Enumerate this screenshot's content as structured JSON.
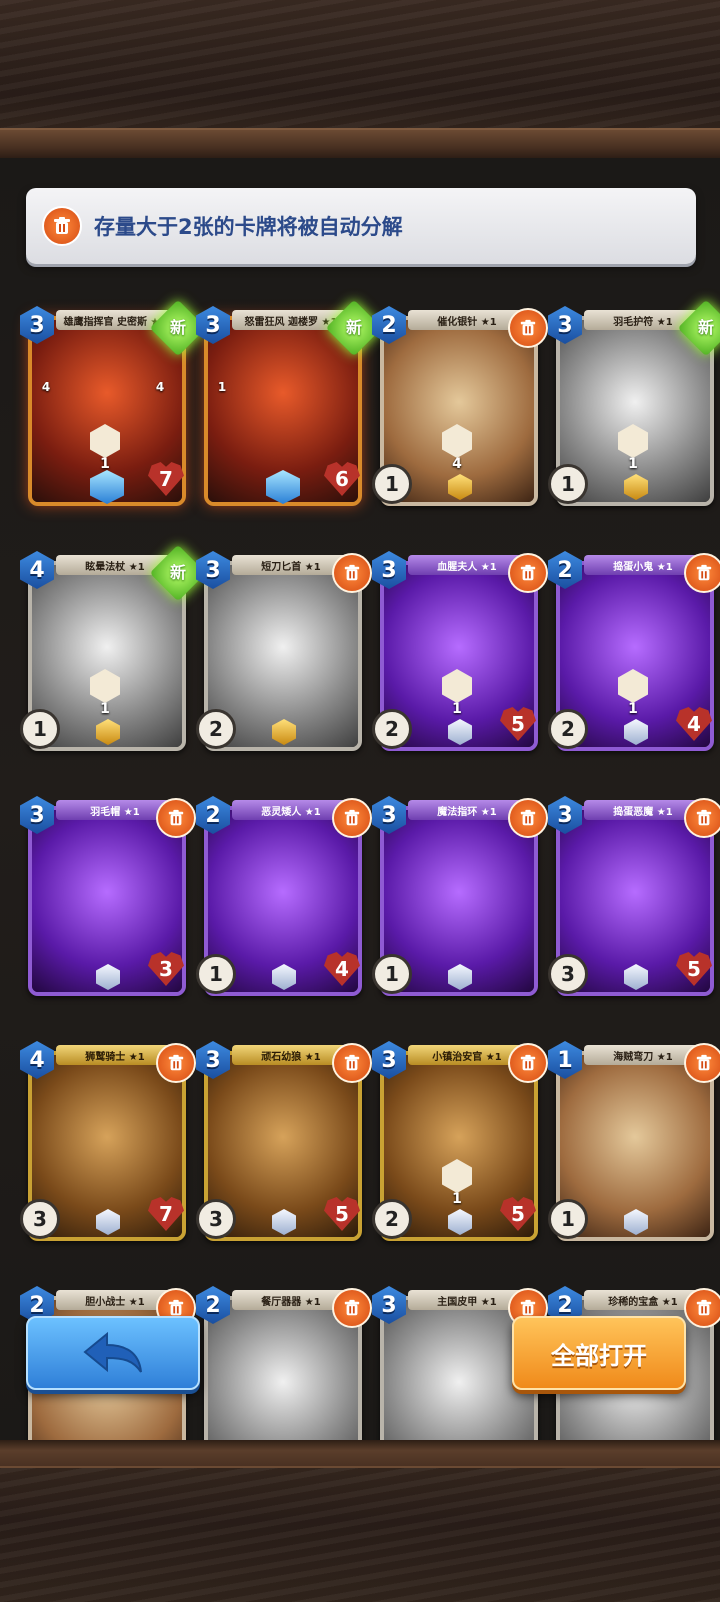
{
  "notice": {
    "text": "存量大于2张的卡牌将被自动分解",
    "icon": "trash-icon"
  },
  "cards": [
    {
      "name": "雄鹰指挥官 史密斯 ★1",
      "cost": "3",
      "badge": "新",
      "theme": "orange",
      "left_stat": "",
      "right_stat": "7",
      "skill1": "1",
      "side_left": "4",
      "side_right": "4",
      "rarity": "gem-blue"
    },
    {
      "name": "怒雷狂风 迦楼罗 ★1",
      "cost": "3",
      "badge": "新",
      "theme": "orange",
      "left_stat": "",
      "right_stat": "6",
      "skill1": "",
      "side_left": "1",
      "side_right": "",
      "rarity": "gem-blue"
    },
    {
      "name": "催化银针 ★1",
      "cost": "2",
      "badge": "trash",
      "theme": "red",
      "left_stat": "1",
      "right_stat": "",
      "skill1": "4",
      "rarity": "gem-gold"
    },
    {
      "name": "羽毛护符 ★1",
      "cost": "3",
      "badge": "新",
      "theme": "gray",
      "left_stat": "1",
      "right_stat": "",
      "skill1": "1",
      "rarity": "gem-gold"
    },
    {
      "name": "眩晕法杖 ★1",
      "cost": "4",
      "badge": "新",
      "theme": "gray",
      "left_stat": "1",
      "right_stat": "",
      "skill1": "1",
      "rarity": "gem-gold"
    },
    {
      "name": "短刀匕首 ★1",
      "cost": "3",
      "badge": "trash",
      "theme": "gray",
      "left_stat": "2",
      "right_stat": "",
      "skill1": "",
      "rarity": "gem-gold"
    },
    {
      "name": "血腥夫人 ★1",
      "cost": "3",
      "badge": "trash",
      "theme": "purple",
      "left_stat": "2",
      "right_stat": "5",
      "skill1": "1",
      "rarity": "gem-silver"
    },
    {
      "name": "捣蛋小鬼 ★1",
      "cost": "2",
      "badge": "trash",
      "theme": "purple",
      "left_stat": "2",
      "right_stat": "4",
      "skill1": "1",
      "rarity": "gem-silver"
    },
    {
      "name": "羽毛帽 ★1",
      "cost": "3",
      "badge": "trash",
      "theme": "purple",
      "left_stat": "",
      "right_stat": "3",
      "skill1": "",
      "rarity": "gem-silver"
    },
    {
      "name": "恶灵矮人 ★1",
      "cost": "2",
      "badge": "trash",
      "theme": "purple",
      "left_stat": "1",
      "right_stat": "4",
      "skill1": "",
      "rarity": "gem-silver"
    },
    {
      "name": "魔法指环 ★1",
      "cost": "3",
      "badge": "trash",
      "theme": "purple",
      "left_stat": "1",
      "right_stat": "",
      "skill1": "",
      "rarity": "gem-silver"
    },
    {
      "name": "捣蛋恶魔 ★1",
      "cost": "3",
      "badge": "trash",
      "theme": "purple",
      "left_stat": "3",
      "right_stat": "5",
      "skill1": "",
      "rarity": "gem-silver"
    },
    {
      "name": "狮鹫骑士 ★1",
      "cost": "4",
      "badge": "trash",
      "theme": "gold",
      "left_stat": "3",
      "right_stat": "7",
      "skill1": "",
      "rarity": "gem-silver"
    },
    {
      "name": "顽石幼狼 ★1",
      "cost": "3",
      "badge": "trash",
      "theme": "gold",
      "left_stat": "3",
      "right_stat": "5",
      "skill1": "",
      "rarity": "gem-silver"
    },
    {
      "name": "小镇治安官 ★1",
      "cost": "3",
      "badge": "trash",
      "theme": "gold",
      "left_stat": "2",
      "right_stat": "5",
      "skill1": "1",
      "rarity": "gem-silver"
    },
    {
      "name": "海贼弯刀 ★1",
      "cost": "1",
      "badge": "trash",
      "theme": "red",
      "left_stat": "1",
      "right_stat": "",
      "skill1": "",
      "rarity": "gem-silver"
    },
    {
      "name": "胆小战士 ★1",
      "cost": "2",
      "badge": "trash",
      "theme": "red",
      "left_stat": "",
      "right_stat": "",
      "skill1": "",
      "rarity": ""
    },
    {
      "name": "餐厅器器 ★1",
      "cost": "2",
      "badge": "trash",
      "theme": "gray",
      "left_stat": "",
      "right_stat": "",
      "skill1": "",
      "rarity": ""
    },
    {
      "name": "主国皮甲 ★1",
      "cost": "3",
      "badge": "trash",
      "theme": "gray",
      "left_stat": "",
      "right_stat": "",
      "skill1": "",
      "rarity": ""
    },
    {
      "name": "珍稀的宝盒 ★1",
      "cost": "2",
      "badge": "trash",
      "theme": "gray",
      "left_stat": "",
      "right_stat": "",
      "skill1": "",
      "rarity": ""
    }
  ],
  "buttons": {
    "back_icon": "back-arrow-icon",
    "open_all_label": "全部打开"
  },
  "colors": {
    "accent_orange": "#f08a1a",
    "accent_blue": "#2f7fd8",
    "new_badge_green": "#4fb022"
  }
}
